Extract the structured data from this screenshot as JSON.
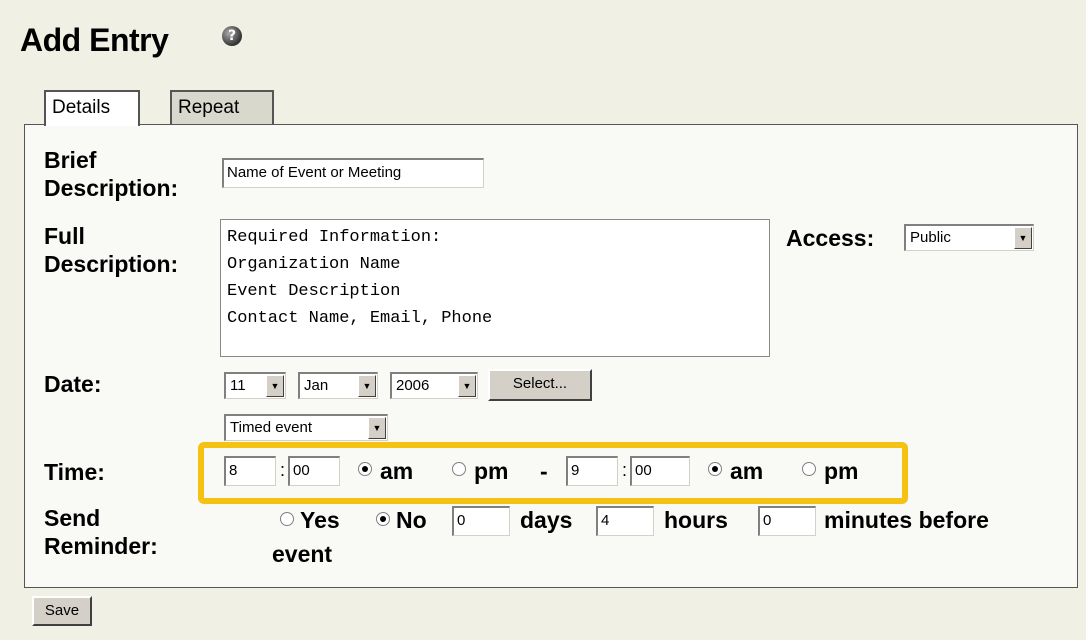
{
  "header": {
    "title": "Add Entry",
    "help_glyph": "?"
  },
  "tabs": [
    {
      "label": "Details"
    },
    {
      "label": "Repeat"
    }
  ],
  "form": {
    "brief_label_line1": "Brief",
    "brief_label_line2": "Description:",
    "brief_value": "Name of Event or Meeting",
    "full_label_line1": "Full",
    "full_label_line2": "Description:",
    "full_value": "Required Information:\nOrganization Name\nEvent Description\nContact Name, Email, Phone",
    "access_label": "Access:",
    "access_value": "Public",
    "date_label": "Date:",
    "day_value": "11",
    "month_value": "Jan",
    "year_value": "2006",
    "select_button": "Select...",
    "event_type_value": "Timed event",
    "time_label": "Time:",
    "start_hour": "8",
    "start_minute": "00",
    "am_label": "am",
    "pm_label": "pm",
    "dash": "-",
    "colon": ":",
    "end_hour": "9",
    "end_minute": "00",
    "reminder_label_line1": "Send",
    "reminder_label_line2": "Reminder:",
    "yes_label": "Yes",
    "no_label": "No",
    "days_value": "0",
    "days_label": "days",
    "hours_value": "4",
    "hours_label": "hours",
    "minutes_value": "0",
    "minutes_label": "minutes before",
    "event_label": "event",
    "save_button": "Save"
  },
  "colors": {
    "highlight": "#f5c213",
    "page_bg": "#f0f0e4"
  },
  "icons": {
    "help": "help-icon",
    "dropdown": "chevron-down-icon"
  }
}
